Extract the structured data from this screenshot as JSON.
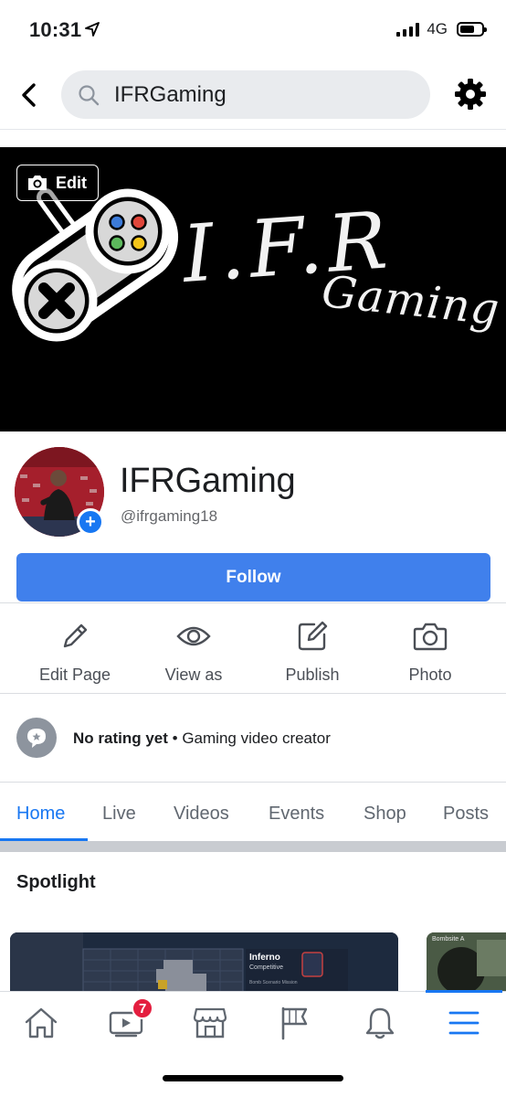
{
  "status_bar": {
    "time": "10:31",
    "network": "4G"
  },
  "header": {
    "search_query": "IFRGaming"
  },
  "cover": {
    "edit_label": "Edit",
    "logo_text_line1": "I.F.R",
    "logo_text_line2": "Gaming"
  },
  "profile": {
    "name": "IFRGaming",
    "handle": "@ifrgaming18",
    "add_photo_symbol": "+"
  },
  "follow_button": {
    "label": "Follow",
    "color": "#4080ec"
  },
  "actions": [
    {
      "label": "Edit Page",
      "icon": "pencil-icon"
    },
    {
      "label": "View as",
      "icon": "eye-icon"
    },
    {
      "label": "Publish",
      "icon": "compose-icon"
    },
    {
      "label": "Photo",
      "icon": "camera-icon"
    }
  ],
  "rating": {
    "rating_text": "No rating yet",
    "separator": "•",
    "category": "Gaming video creator"
  },
  "tabs": [
    {
      "label": "Home",
      "active": true
    },
    {
      "label": "Live",
      "active": false
    },
    {
      "label": "Videos",
      "active": false
    },
    {
      "label": "Events",
      "active": false
    },
    {
      "label": "Shop",
      "active": false
    },
    {
      "label": "Posts",
      "active": false
    }
  ],
  "spotlight": {
    "title": "Spotlight",
    "card1": {
      "map_name": "Inferno",
      "mode": "Competitive",
      "sub": "Bomb Scenario Mission"
    },
    "card2": {
      "label": "Bombsite A"
    }
  },
  "bottom_nav": {
    "items": [
      "home-icon",
      "watch-icon",
      "marketplace-icon",
      "pages-flag-icon",
      "notifications-bell-icon",
      "menu-icon"
    ],
    "watch_badge": "7",
    "active_item": "menu-icon"
  },
  "colors": {
    "accent": "#1877f2",
    "badge": "#e41e3f",
    "cover_bg": "#000000"
  }
}
